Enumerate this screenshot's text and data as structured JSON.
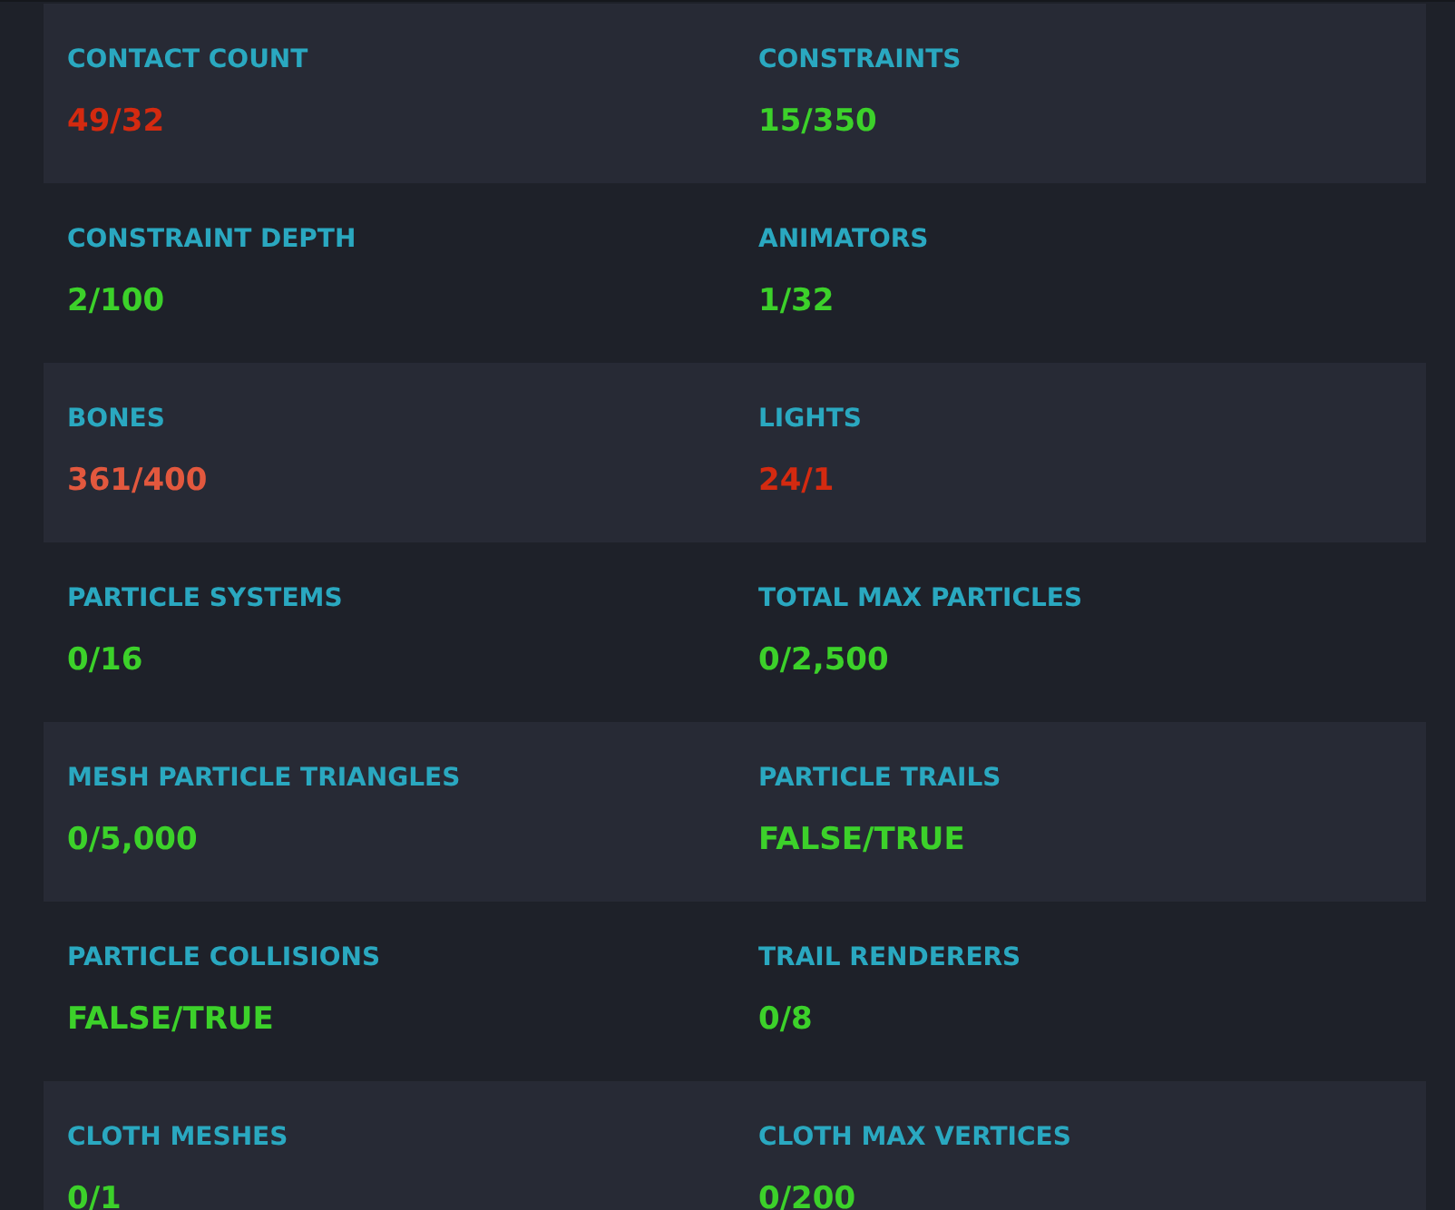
{
  "rows": [
    {
      "cells": [
        {
          "label": "CONTACT COUNT",
          "value": "49/32",
          "color": "#d42a10"
        },
        {
          "label": "CONSTRAINTS",
          "value": "15/350",
          "color": "#3cd12a"
        }
      ]
    },
    {
      "cells": [
        {
          "label": "CONSTRAINT DEPTH",
          "value": "2/100",
          "color": "#3cd12a"
        },
        {
          "label": "ANIMATORS",
          "value": "1/32",
          "color": "#3cd12a"
        }
      ]
    },
    {
      "cells": [
        {
          "label": "BONES",
          "value": "361/400",
          "color": "#e2583e"
        },
        {
          "label": "LIGHTS",
          "value": "24/1",
          "color": "#d42a10"
        }
      ]
    },
    {
      "cells": [
        {
          "label": "PARTICLE SYSTEMS",
          "value": "0/16",
          "color": "#3cd12a"
        },
        {
          "label": "TOTAL MAX PARTICLES",
          "value": "0/2,500",
          "color": "#3cd12a"
        }
      ]
    },
    {
      "cells": [
        {
          "label": "MESH PARTICLE TRIANGLES",
          "value": "0/5,000",
          "color": "#3cd12a"
        },
        {
          "label": "PARTICLE TRAILS",
          "value": "FALSE/TRUE",
          "color": "#3cd12a"
        }
      ]
    },
    {
      "cells": [
        {
          "label": "PARTICLE COLLISIONS",
          "value": "FALSE/TRUE",
          "color": "#3cd12a"
        },
        {
          "label": "TRAIL RENDERERS",
          "value": "0/8",
          "color": "#3cd12a"
        }
      ]
    },
    {
      "cells": [
        {
          "label": "CLOTH MESHES",
          "value": "0/1",
          "color": "#3cd12a"
        },
        {
          "label": "CLOTH MAX VERTICES",
          "value": "0/200",
          "color": "#3cd12a"
        }
      ]
    }
  ]
}
